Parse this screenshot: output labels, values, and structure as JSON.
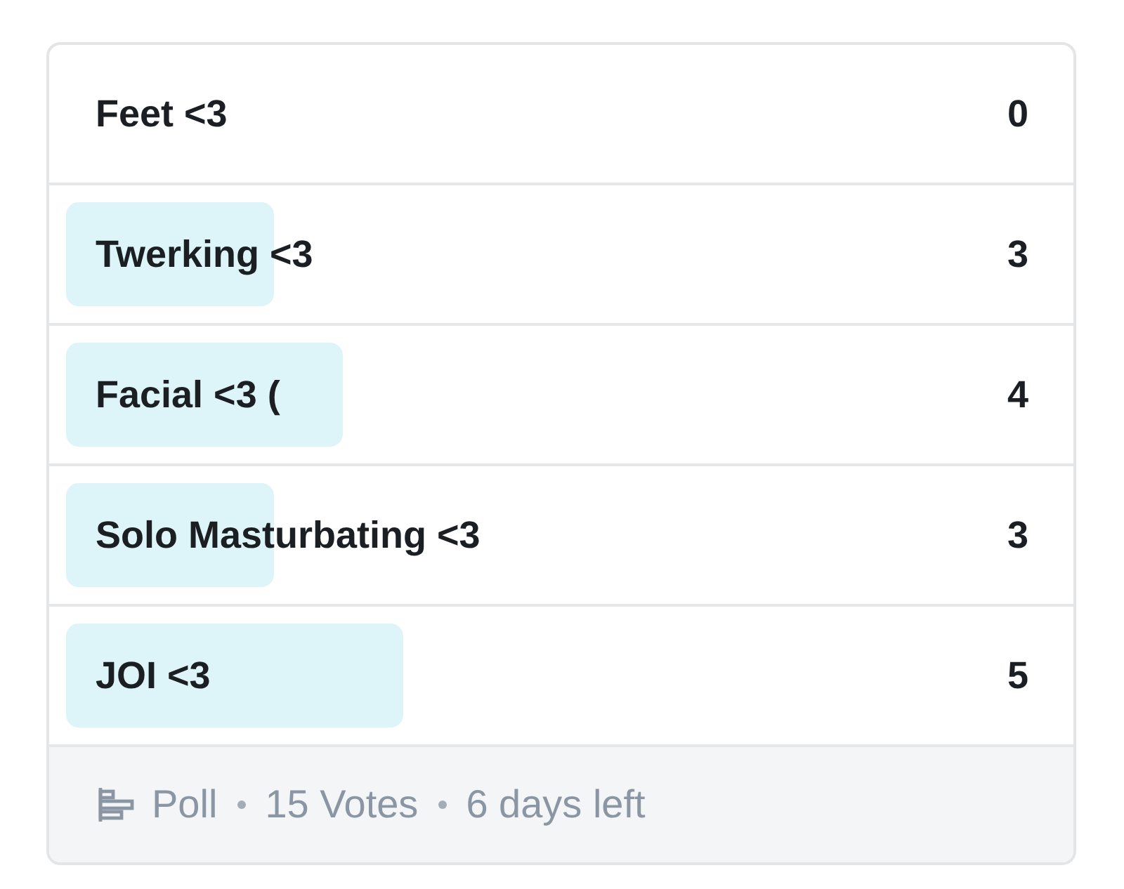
{
  "options": [
    {
      "label": "Feet <3",
      "count": "0"
    },
    {
      "label": "Twerking <3",
      "count": "3",
      "level": 0.21
    },
    {
      "label": "Facial <3 (",
      "count": "4",
      "level": 0.28
    },
    {
      "label": "Solo Masturbating <3",
      "count": "3",
      "level": 0.21
    },
    {
      "label": "JOI <3",
      "count": "5",
      "level": 0.34
    }
  ],
  "footer": {
    "type": "Poll",
    "votes": "15 Votes",
    "time_left": "6 days left"
  }
}
